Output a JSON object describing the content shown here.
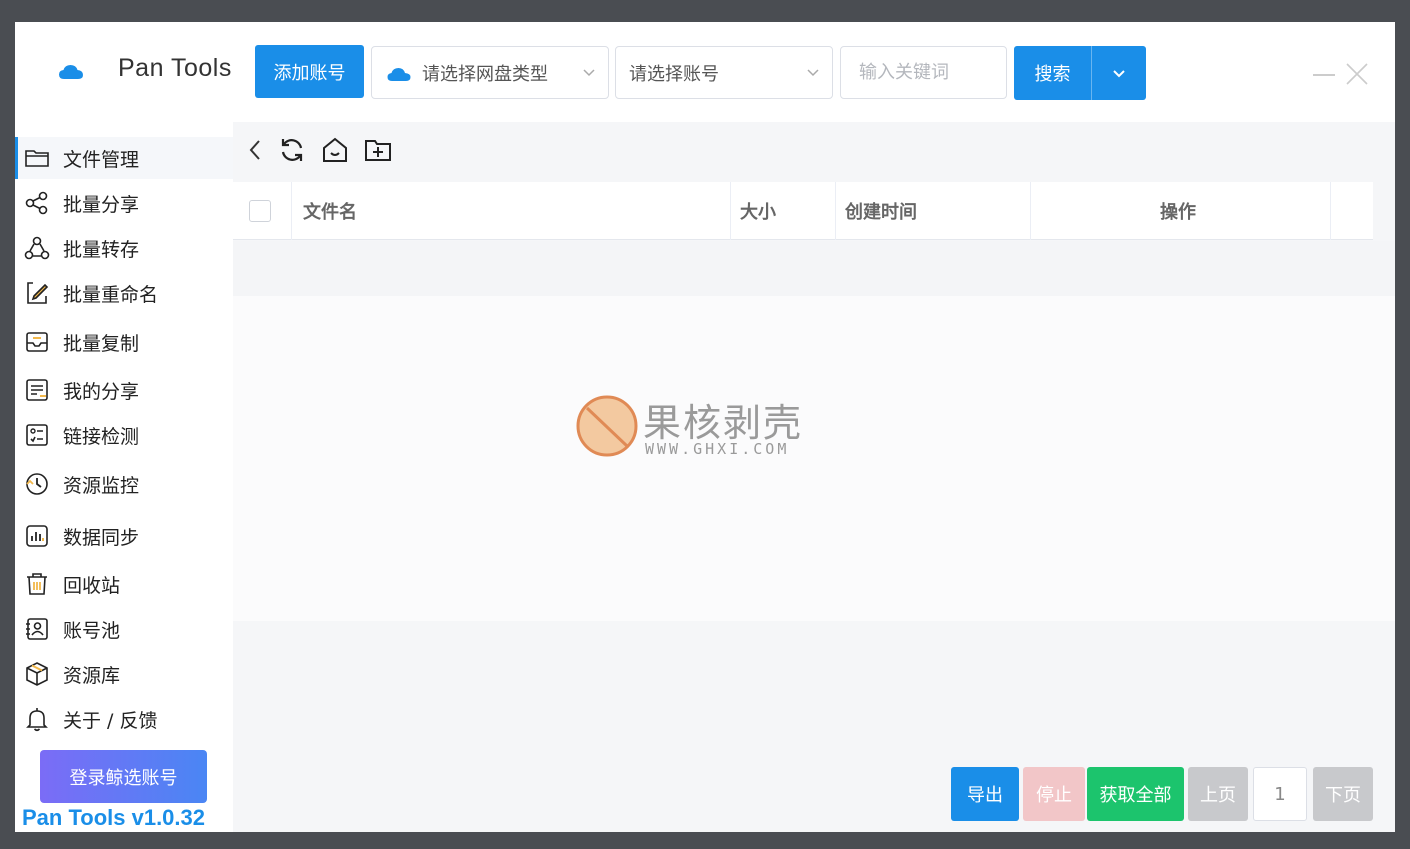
{
  "header": {
    "app_title": "Pan Tools",
    "add_account_label": "添加账号",
    "disk_type_placeholder": "请选择网盘类型",
    "account_placeholder": "请选择账号",
    "keyword_placeholder": "输入关键词",
    "search_label": "搜索"
  },
  "sidebar": {
    "items": [
      {
        "label": "文件管理",
        "icon": "folder-icon"
      },
      {
        "label": "批量分享",
        "icon": "share-icon"
      },
      {
        "label": "批量转存",
        "icon": "transfer-icon"
      },
      {
        "label": "批量重命名",
        "icon": "rename-icon"
      },
      {
        "label": "批量复制",
        "icon": "copy-icon"
      },
      {
        "label": "我的分享",
        "icon": "my-share-icon"
      },
      {
        "label": "链接检测",
        "icon": "link-check-icon"
      },
      {
        "label": "资源监控",
        "icon": "monitor-icon"
      },
      {
        "label": "数据同步",
        "icon": "sync-chart-icon"
      },
      {
        "label": "回收站",
        "icon": "trash-icon"
      },
      {
        "label": "账号池",
        "icon": "account-pool-icon"
      },
      {
        "label": "资源库",
        "icon": "package-icon"
      },
      {
        "label": "关于 / 反馈",
        "icon": "bell-icon"
      }
    ],
    "login_button_label": "登录鲸选账号",
    "version": "Pan Tools v1.0.32"
  },
  "table": {
    "columns": [
      "文件名",
      "大小",
      "创建时间",
      "操作"
    ]
  },
  "watermark": {
    "text": "果核剥壳",
    "url": "WWW.GHXI.COM"
  },
  "pager": {
    "export_label": "导出",
    "stop_label": "停止",
    "get_all_label": "获取全部",
    "prev_label": "上页",
    "page_number": "1",
    "next_label": "下页"
  },
  "colors": {
    "primary": "#1a8ee8",
    "success": "#1cc46d",
    "disabled": "#c8c9cc",
    "stop_disabled": "#f2c6c8",
    "login_gradient_start": "#7b6cf6",
    "login_gradient_end": "#4a86f4"
  }
}
